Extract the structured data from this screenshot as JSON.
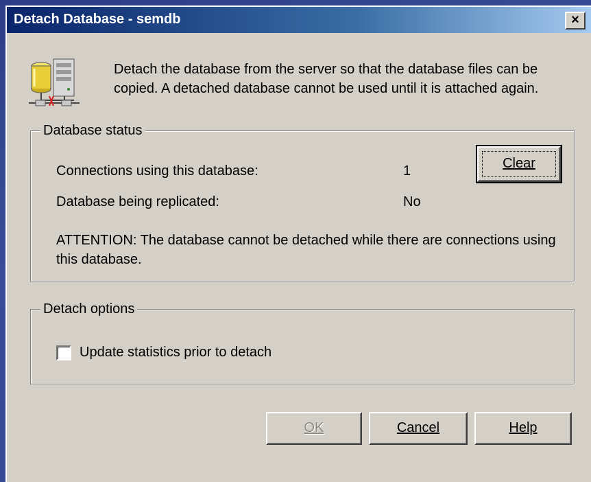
{
  "window": {
    "title": "Detach Database - semdb",
    "close_label": "×"
  },
  "icon_name": "database-server-icon",
  "description": "Detach the database from the server so that the database files can be copied. A detached database cannot be used until it is attached again.",
  "status_group": {
    "label": "Database status",
    "connections_label": "Connections using this database:",
    "connections_value": "1",
    "clear_button": "Clear",
    "replicated_label": "Database being replicated:",
    "replicated_value": "No",
    "attention": "ATTENTION:  The database cannot be detached while there are connections using this database."
  },
  "options_group": {
    "label": "Detach options",
    "update_stats_label": "Update statistics prior to detach",
    "update_stats_checked": false
  },
  "buttons": {
    "ok": "OK",
    "cancel": "Cancel",
    "help": "Help"
  },
  "colors": {
    "dialog_bg": "#d4d0c8",
    "titlebar_start": "#0a246a",
    "titlebar_end": "#a6caf0",
    "desktop": "#2d3e86"
  }
}
